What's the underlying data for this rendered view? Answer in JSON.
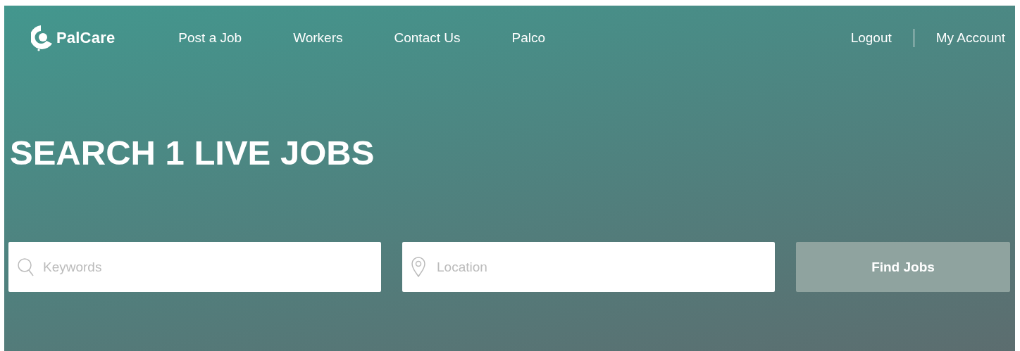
{
  "brand": {
    "name": "PalCare"
  },
  "nav": [
    {
      "label": "Post a Job"
    },
    {
      "label": "Workers"
    },
    {
      "label": "Contact Us"
    },
    {
      "label": "Palco"
    }
  ],
  "account_links": [
    {
      "label": "Logout"
    },
    {
      "label": "My Account"
    }
  ],
  "heading": "SEARCH 1 LIVE JOBS",
  "search": {
    "keywords": {
      "placeholder": "Keywords"
    },
    "location": {
      "placeholder": "Location"
    },
    "button": "Find Jobs"
  }
}
